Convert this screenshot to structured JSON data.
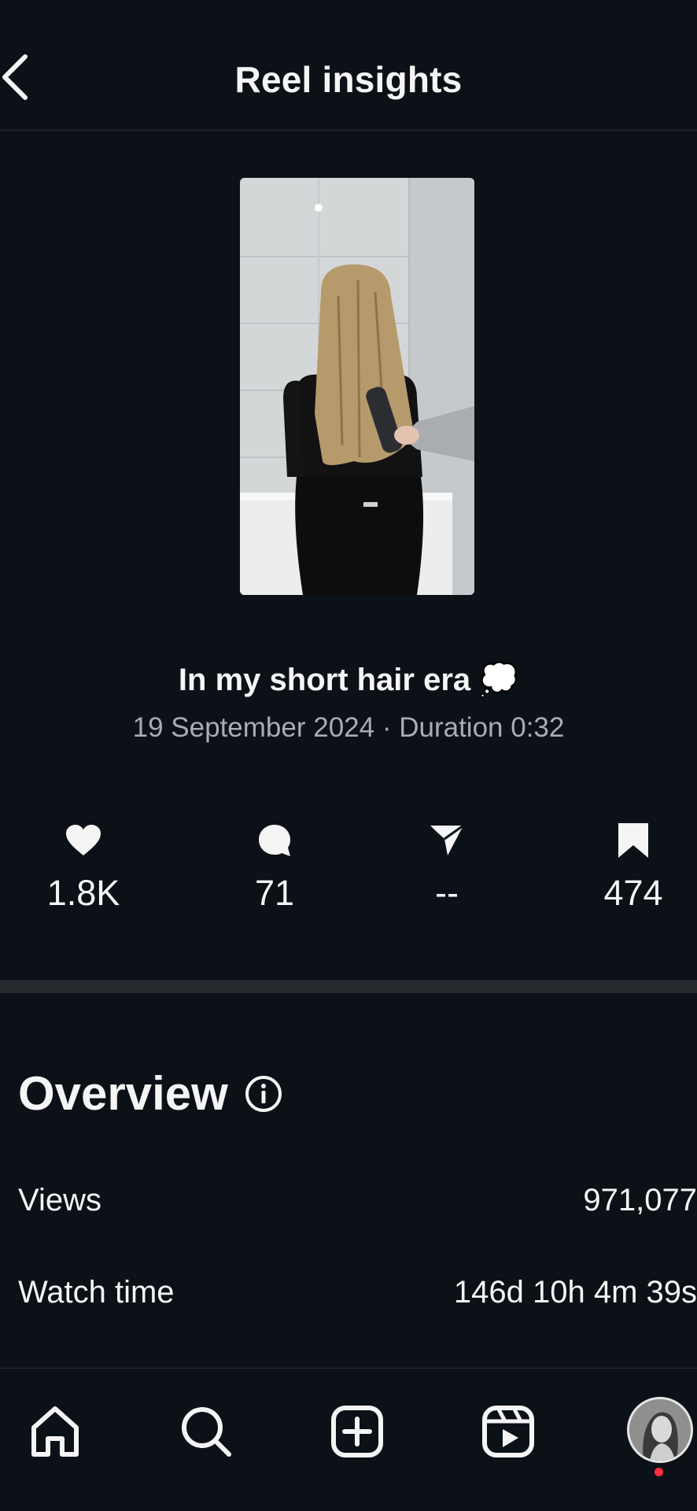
{
  "header": {
    "title": "Reel insights",
    "back_icon": "chevron-left-icon"
  },
  "reel": {
    "thumbnail": "reel-thumbnail",
    "caption": "In my short hair era 💭",
    "meta": "19 September 2024 · Duration 0:32"
  },
  "stats": [
    {
      "icon": "heart-icon",
      "value": "1.8K"
    },
    {
      "icon": "comment-icon",
      "value": "71"
    },
    {
      "icon": "send-icon",
      "value": "--"
    },
    {
      "icon": "bookmark-icon",
      "value": "474"
    }
  ],
  "overview": {
    "title": "Overview",
    "info_icon": "info-icon",
    "rows": [
      {
        "label": "Views",
        "value": "971,077"
      },
      {
        "label": "Watch time",
        "value": "146d 10h 4m 39s"
      }
    ]
  },
  "bottom_nav": {
    "items": [
      "home-icon",
      "search-icon",
      "create-icon",
      "reels-icon",
      "profile-avatar"
    ],
    "notification_color": "#ff3040"
  },
  "colors": {
    "background": "#0c1017",
    "text": "#f5f5f5",
    "muted_text": "#a8acb3",
    "divider": "#25282d"
  }
}
